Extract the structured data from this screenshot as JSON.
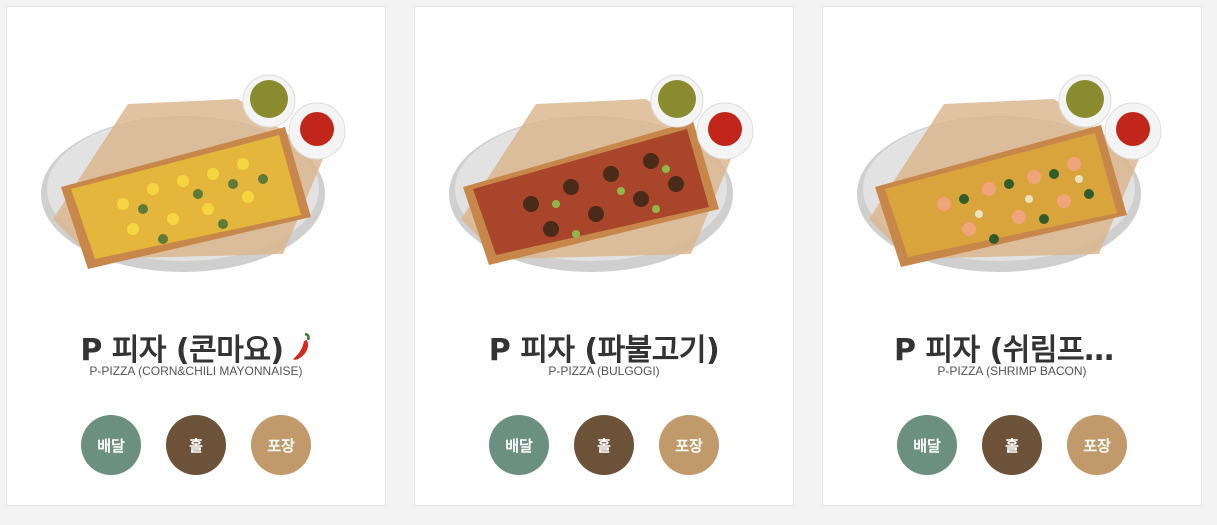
{
  "colors": {
    "delivery": "#6b8f81",
    "dine_in": "#6b5238",
    "takeout": "#c19a6b"
  },
  "products": [
    {
      "name": "P 피자 (콘마요)",
      "name_en": "P-PIZZA (CORN&CHILI MAYONNAISE)",
      "spicy_icon": "chili-pepper-icon",
      "buttons": {
        "delivery": "배달",
        "dine_in": "홀",
        "takeout": "포장"
      }
    },
    {
      "name": "P 피자 (파불고기)",
      "name_en": "P-PIZZA (BULGOGI)",
      "buttons": {
        "delivery": "배달",
        "dine_in": "홀",
        "takeout": "포장"
      }
    },
    {
      "name": "P 피자 (쉬림프베이컨)",
      "name_en": "P-PIZZA (SHRIMP BACON)",
      "buttons": {
        "delivery": "배달",
        "dine_in": "홀",
        "takeout": "포장"
      }
    }
  ]
}
